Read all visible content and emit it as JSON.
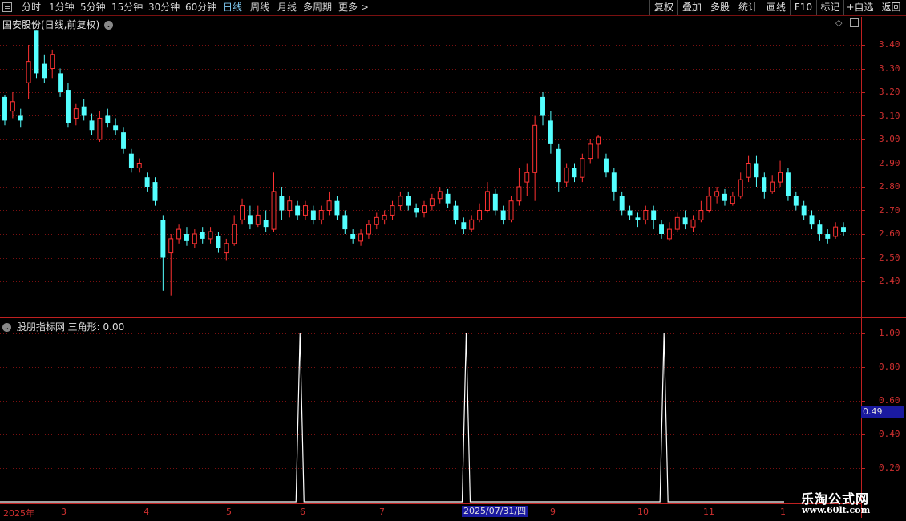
{
  "toolbar": {
    "timeframes": [
      "分时",
      "1分钟",
      "5分钟",
      "15分钟",
      "30分钟",
      "60分钟",
      "日线",
      "周线",
      "月线",
      "多周期",
      "更多 >"
    ],
    "active_timeframe": "日线",
    "right_buttons": [
      "复权",
      "叠加",
      "多股",
      "统计",
      "画线",
      "F10",
      "标记",
      "+自选",
      "返回"
    ]
  },
  "main_panel": {
    "title": "国安股份(日线,前复权)",
    "price_axis": [
      "3.40",
      "3.30",
      "3.20",
      "3.10",
      "3.00",
      "2.90",
      "2.80",
      "2.70",
      "2.60",
      "2.50",
      "2.40"
    ]
  },
  "indicator_panel": {
    "title": "股朋指标网 三角形: 0.00",
    "axis": [
      "1.00",
      "0.80",
      "0.60",
      "0.40",
      "0.20"
    ],
    "cursor_value": "0.49"
  },
  "x_axis": {
    "labels": [
      "2025年",
      "3",
      "4",
      "5",
      "6",
      "7",
      "2025/07/31/四",
      "9",
      "10",
      "11",
      "1"
    ]
  },
  "watermark": {
    "line1": "乐淘公式网",
    "line2": "www.60lt.com"
  },
  "colors": {
    "up": "#ff3232",
    "down": "#54ffff",
    "axis": "#c02020",
    "grid": "#7a1010",
    "cursor": "#1a1aa0"
  },
  "chart_data": {
    "type": "candlestick",
    "ylim": [
      2.32,
      3.48
    ],
    "candles": [
      [
        3.18,
        3.08,
        3.19,
        3.06
      ],
      [
        3.12,
        3.16,
        3.2,
        3.09
      ],
      [
        3.1,
        3.08,
        3.13,
        3.05
      ],
      [
        3.24,
        3.33,
        3.4,
        3.17
      ],
      [
        3.46,
        3.28,
        3.46,
        3.26
      ],
      [
        3.32,
        3.26,
        3.36,
        3.24
      ],
      [
        3.3,
        3.36,
        3.38,
        3.26
      ],
      [
        3.28,
        3.2,
        3.3,
        3.18
      ],
      [
        3.21,
        3.07,
        3.24,
        3.05
      ],
      [
        3.09,
        3.13,
        3.15,
        3.06
      ],
      [
        3.14,
        3.1,
        3.17,
        3.08
      ],
      [
        3.08,
        3.04,
        3.11,
        3.02
      ],
      [
        3.0,
        3.09,
        3.12,
        2.99
      ],
      [
        3.1,
        3.07,
        3.13,
        3.05
      ],
      [
        3.06,
        3.04,
        3.09,
        3.02
      ],
      [
        3.03,
        2.96,
        3.05,
        2.94
      ],
      [
        2.94,
        2.88,
        2.96,
        2.86
      ],
      [
        2.88,
        2.9,
        2.92,
        2.86
      ],
      [
        2.84,
        2.8,
        2.86,
        2.78
      ],
      [
        2.82,
        2.74,
        2.84,
        2.72
      ],
      [
        2.66,
        2.5,
        2.68,
        2.36
      ],
      [
        2.52,
        2.58,
        2.6,
        2.34
      ],
      [
        2.58,
        2.62,
        2.64,
        2.56
      ],
      [
        2.6,
        2.57,
        2.63,
        2.55
      ],
      [
        2.56,
        2.6,
        2.62,
        2.54
      ],
      [
        2.61,
        2.58,
        2.63,
        2.56
      ],
      [
        2.58,
        2.61,
        2.63,
        2.56
      ],
      [
        2.59,
        2.54,
        2.61,
        2.52
      ],
      [
        2.52,
        2.56,
        2.58,
        2.49
      ],
      [
        2.56,
        2.64,
        2.68,
        2.55
      ],
      [
        2.66,
        2.72,
        2.75,
        2.64
      ],
      [
        2.68,
        2.64,
        2.72,
        2.62
      ],
      [
        2.64,
        2.68,
        2.72,
        2.63
      ],
      [
        2.66,
        2.63,
        2.7,
        2.61
      ],
      [
        2.62,
        2.78,
        2.86,
        2.61
      ],
      [
        2.76,
        2.7,
        2.8,
        2.66
      ],
      [
        2.7,
        2.74,
        2.76,
        2.67
      ],
      [
        2.72,
        2.68,
        2.74,
        2.66
      ],
      [
        2.68,
        2.72,
        2.74,
        2.66
      ],
      [
        2.7,
        2.66,
        2.72,
        2.64
      ],
      [
        2.66,
        2.7,
        2.72,
        2.64
      ],
      [
        2.7,
        2.74,
        2.78,
        2.68
      ],
      [
        2.74,
        2.68,
        2.76,
        2.66
      ],
      [
        2.68,
        2.62,
        2.7,
        2.6
      ],
      [
        2.6,
        2.58,
        2.62,
        2.56
      ],
      [
        2.57,
        2.6,
        2.62,
        2.55
      ],
      [
        2.6,
        2.64,
        2.66,
        2.58
      ],
      [
        2.64,
        2.67,
        2.69,
        2.62
      ],
      [
        2.66,
        2.68,
        2.7,
        2.64
      ],
      [
        2.68,
        2.72,
        2.74,
        2.66
      ],
      [
        2.72,
        2.76,
        2.78,
        2.7
      ],
      [
        2.76,
        2.72,
        2.78,
        2.7
      ],
      [
        2.71,
        2.69,
        2.73,
        2.67
      ],
      [
        2.69,
        2.72,
        2.74,
        2.67
      ],
      [
        2.72,
        2.75,
        2.77,
        2.7
      ],
      [
        2.75,
        2.78,
        2.8,
        2.73
      ],
      [
        2.77,
        2.73,
        2.79,
        2.71
      ],
      [
        2.72,
        2.66,
        2.74,
        2.64
      ],
      [
        2.65,
        2.62,
        2.67,
        2.6
      ],
      [
        2.62,
        2.66,
        2.68,
        2.61
      ],
      [
        2.66,
        2.7,
        2.73,
        2.65
      ],
      [
        2.7,
        2.78,
        2.82,
        2.69
      ],
      [
        2.77,
        2.7,
        2.79,
        2.68
      ],
      [
        2.7,
        2.66,
        2.72,
        2.64
      ],
      [
        2.66,
        2.74,
        2.76,
        2.65
      ],
      [
        2.74,
        2.8,
        2.88,
        2.72
      ],
      [
        2.82,
        2.86,
        2.9,
        2.76
      ],
      [
        2.86,
        3.06,
        3.1,
        2.74
      ],
      [
        3.18,
        3.1,
        3.2,
        3.06
      ],
      [
        3.08,
        2.98,
        3.12,
        2.94
      ],
      [
        2.96,
        2.82,
        2.98,
        2.78
      ],
      [
        2.82,
        2.88,
        2.9,
        2.8
      ],
      [
        2.88,
        2.84,
        2.9,
        2.82
      ],
      [
        2.84,
        2.92,
        2.94,
        2.82
      ],
      [
        2.92,
        2.98,
        3.0,
        2.9
      ],
      [
        2.98,
        3.01,
        3.02,
        2.92
      ],
      [
        2.92,
        2.86,
        2.94,
        2.84
      ],
      [
        2.86,
        2.78,
        2.88,
        2.74
      ],
      [
        2.76,
        2.7,
        2.78,
        2.68
      ],
      [
        2.7,
        2.68,
        2.72,
        2.66
      ],
      [
        2.67,
        2.66,
        2.69,
        2.63
      ],
      [
        2.66,
        2.7,
        2.72,
        2.64
      ],
      [
        2.7,
        2.66,
        2.72,
        2.62
      ],
      [
        2.64,
        2.6,
        2.66,
        2.58
      ],
      [
        2.58,
        2.62,
        2.65,
        2.57
      ],
      [
        2.62,
        2.67,
        2.69,
        2.61
      ],
      [
        2.67,
        2.64,
        2.7,
        2.62
      ],
      [
        2.63,
        2.66,
        2.68,
        2.61
      ],
      [
        2.66,
        2.7,
        2.74,
        2.65
      ],
      [
        2.7,
        2.76,
        2.8,
        2.69
      ],
      [
        2.76,
        2.78,
        2.8,
        2.73
      ],
      [
        2.77,
        2.74,
        2.79,
        2.72
      ],
      [
        2.73,
        2.76,
        2.78,
        2.72
      ],
      [
        2.76,
        2.83,
        2.86,
        2.75
      ],
      [
        2.84,
        2.9,
        2.93,
        2.82
      ],
      [
        2.9,
        2.84,
        2.93,
        2.8
      ],
      [
        2.84,
        2.78,
        2.86,
        2.75
      ],
      [
        2.78,
        2.82,
        2.85,
        2.77
      ],
      [
        2.82,
        2.86,
        2.91,
        2.8
      ],
      [
        2.86,
        2.76,
        2.88,
        2.74
      ],
      [
        2.76,
        2.72,
        2.78,
        2.7
      ],
      [
        2.72,
        2.68,
        2.74,
        2.66
      ],
      [
        2.68,
        2.64,
        2.7,
        2.62
      ],
      [
        2.64,
        2.6,
        2.66,
        2.57
      ],
      [
        2.6,
        2.58,
        2.62,
        2.56
      ],
      [
        2.59,
        2.63,
        2.65,
        2.58
      ],
      [
        2.63,
        2.61,
        2.65,
        2.59
      ]
    ],
    "indicator": {
      "type": "line",
      "ylim": [
        0,
        1.0
      ],
      "spike_candle_indices": [
        36,
        57,
        82
      ]
    }
  }
}
